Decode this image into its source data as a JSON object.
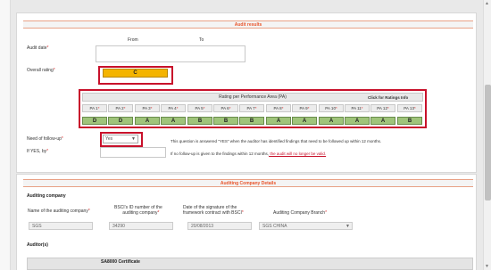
{
  "audit_results": {
    "title": "Audit results",
    "from_label": "From",
    "to_label": "To",
    "audit_date_label": "Audit date",
    "overall_rating_label": "Overall rating",
    "overall_rating_value": "C",
    "pa_table_title": "Rating per Performance Area (PA)",
    "pa_click_label": "Click for Ratings Info",
    "pa_areas": [
      {
        "name": "PA 1",
        "value": "D"
      },
      {
        "name": "PA 2",
        "value": "D"
      },
      {
        "name": "PA 3",
        "value": "A"
      },
      {
        "name": "PA 4",
        "value": "A"
      },
      {
        "name": "PA 5",
        "value": "B"
      },
      {
        "name": "PA 6",
        "value": "B"
      },
      {
        "name": "PA 7",
        "value": "B"
      },
      {
        "name": "PA 8",
        "value": "A"
      },
      {
        "name": "PA 9",
        "value": "A"
      },
      {
        "name": "PA 10",
        "value": "A"
      },
      {
        "name": "PA 11",
        "value": "A"
      },
      {
        "name": "PA 12",
        "value": "A"
      },
      {
        "name": "PA 13",
        "value": "B"
      }
    ],
    "followup_label": "Need of follow-up",
    "followup_value": "Yes",
    "followup_note": "This question is answered \"YES\" when the auditor has identified findings that need to be followed up within 12 months.",
    "if_yes_label": "If YES, by",
    "if_yes_note_prefix": "If no follow-up is given to the findings within 12 months,",
    "if_yes_note_link": " the audit will no longer be valid."
  },
  "auditing_company": {
    "title": "Auditing Company Details",
    "subtitle": "Auditing company",
    "name_label": "Name of the auditing company",
    "name_value": "SGS",
    "bsci_id_label_1": "BSCI's ID number of the",
    "bsci_id_label_2": "auditing company",
    "bsci_id_value": "34290",
    "sign_date_label_1": "Date of the signature of the",
    "sign_date_label_2": "framework contract with BSCI",
    "sign_date_value": "20/08/2013",
    "branch_label": "Auditing Company Branch",
    "branch_value": "SGS CHINA",
    "auditors_label": "Auditor(s)",
    "sa8000_label": "SA8000 Certificate"
  },
  "colors": {
    "accent": "#e8542a",
    "highlight": "#c8112b",
    "rating": "#f4b400",
    "pa_value": "#9fc47a"
  }
}
